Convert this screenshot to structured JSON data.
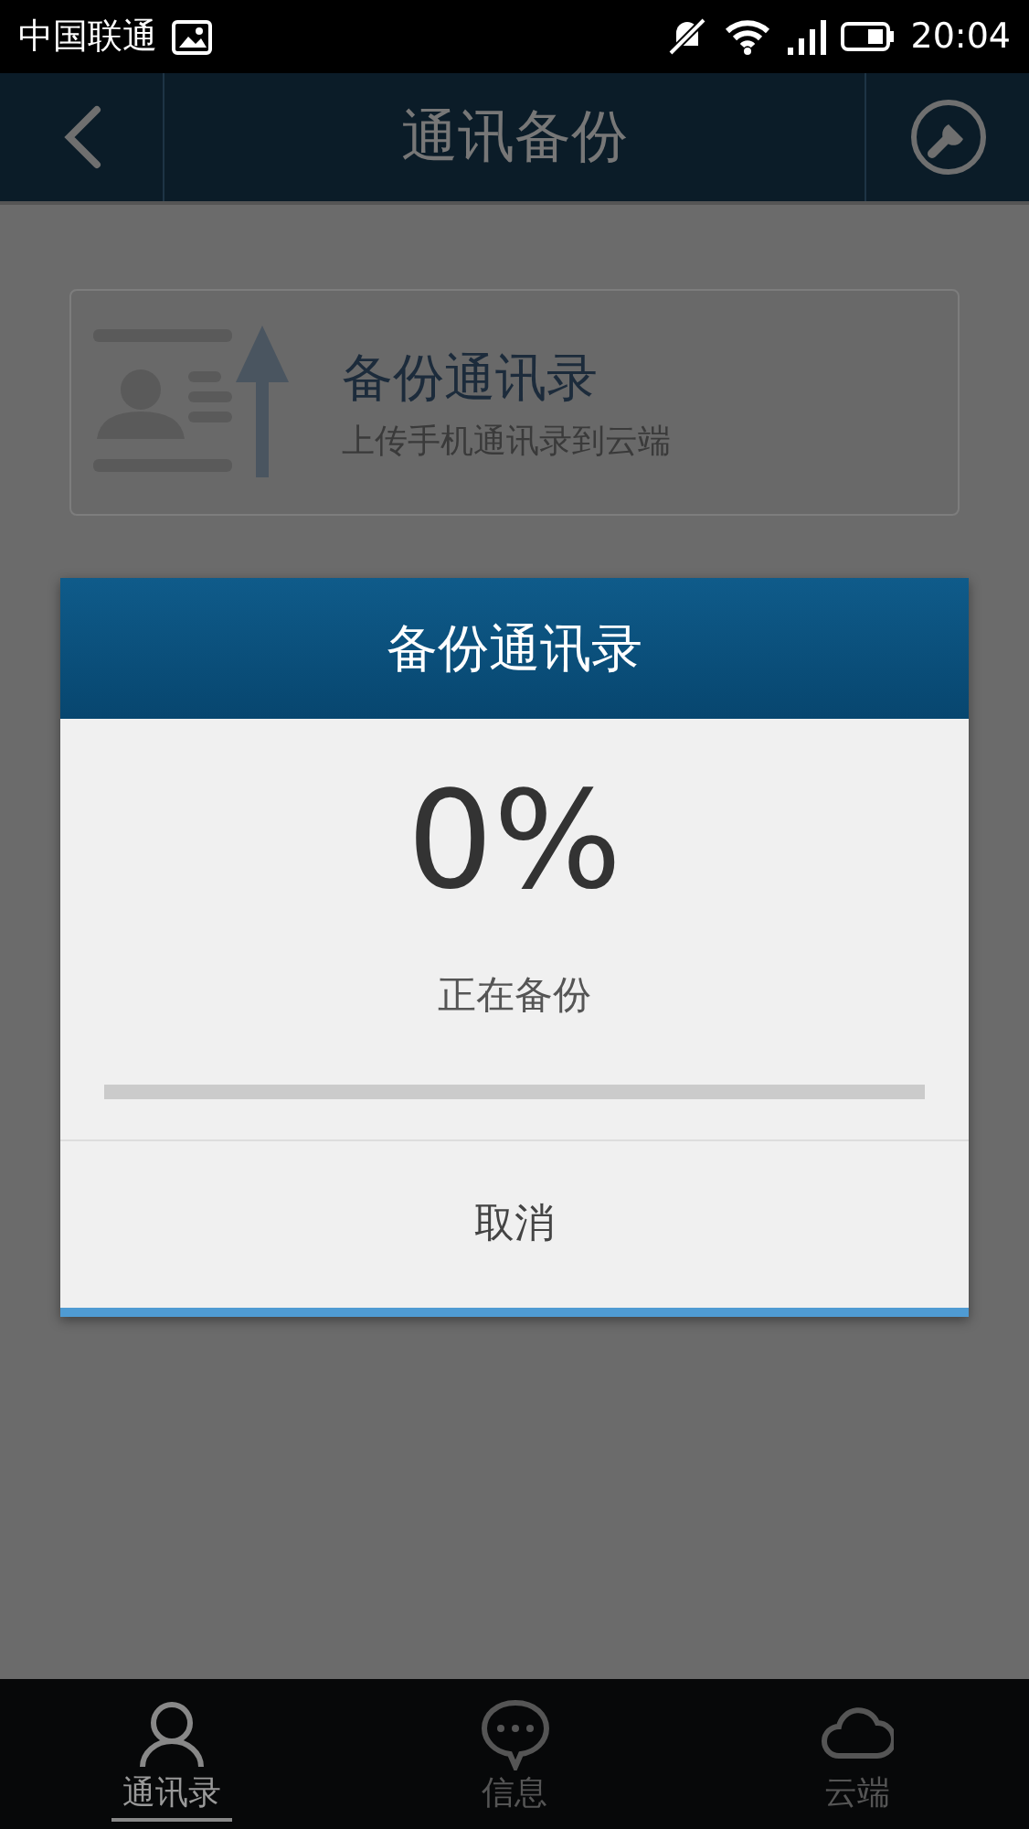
{
  "status_bar": {
    "carrier": "中国联通",
    "time": "20:04"
  },
  "header": {
    "title": "通讯备份"
  },
  "backup_card": {
    "title": "备份通讯录",
    "subtitle": "上传手机通讯录到云端"
  },
  "dialog": {
    "title": "备份通讯录",
    "percent": "0%",
    "status": "正在备份",
    "level": 0,
    "cancel": "取消"
  },
  "tabs": [
    {
      "label": "通讯录",
      "kind": "person",
      "selected": true
    },
    {
      "label": "信息",
      "kind": "chat",
      "selected": false
    },
    {
      "label": "云端",
      "kind": "cloud",
      "selected": false
    }
  ]
}
